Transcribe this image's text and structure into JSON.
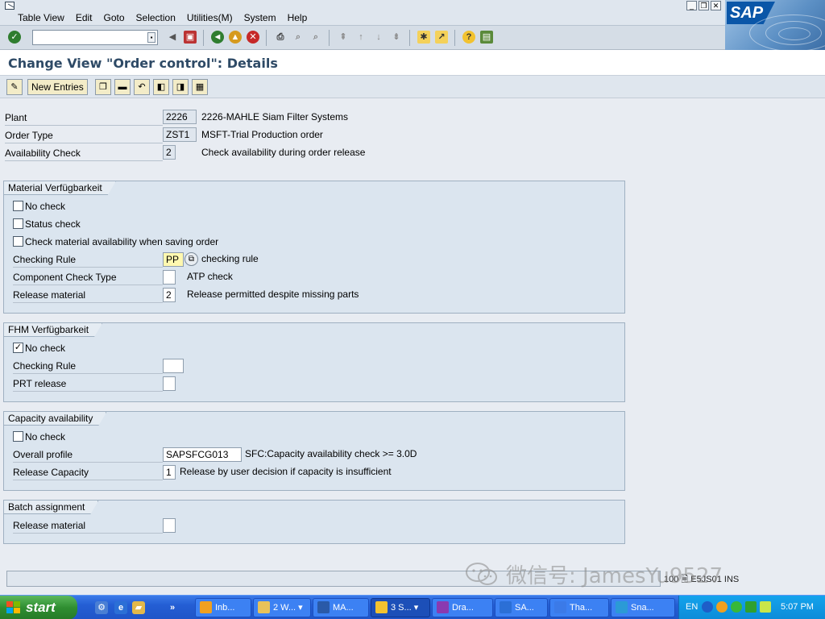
{
  "menubar": {
    "items": [
      "Table View",
      "Edit",
      "Goto",
      "Selection",
      "Utilities(M)",
      "System",
      "Help"
    ]
  },
  "brand": {
    "logo_text": "SAP",
    "accent": "#0a56a8"
  },
  "toolbar": {
    "command_field_value": ""
  },
  "title": "Change View \"Order control\": Details",
  "app_toolbar": {
    "new_entries_label": "New Entries"
  },
  "header": {
    "plant": {
      "label": "Plant",
      "value": "2226",
      "desc": "2226-MAHLE Siam Filter Systems"
    },
    "order_type": {
      "label": "Order Type",
      "value": "ZST1",
      "desc": "MSFT-Trial Production order"
    },
    "availability_check": {
      "label": "Availability Check",
      "value": "2",
      "desc": "Check availability during order release"
    }
  },
  "material_group": {
    "title": "Material Verfügbarkeit",
    "no_check": {
      "label": "No check",
      "checked": false
    },
    "status_check": {
      "label": "Status check",
      "checked": false
    },
    "check_on_save": {
      "label": "Check material availability when saving order",
      "checked": false
    },
    "checking_rule": {
      "label": "Checking Rule",
      "value": "PP",
      "desc": "checking rule"
    },
    "component_check_type": {
      "label": "Component Check Type",
      "value": "",
      "desc": "ATP check"
    },
    "release_material": {
      "label": "Release material",
      "value": "2",
      "desc": "Release permitted despite missing parts"
    }
  },
  "fhm_group": {
    "title": "FHM Verfügbarkeit",
    "no_check": {
      "label": "No check",
      "checked": true
    },
    "checking_rule": {
      "label": "Checking Rule",
      "value": ""
    },
    "prt_release": {
      "label": "PRT release",
      "value": ""
    }
  },
  "capacity_group": {
    "title": "Capacity availability",
    "no_check": {
      "label": "No check",
      "checked": false
    },
    "overall_profile": {
      "label": "Overall profile",
      "value": "SAPSFCG013",
      "desc": "SFC:Capacity availability check >= 3.0D"
    },
    "release_capacity": {
      "label": "Release Capacity",
      "value": "1",
      "desc": "Release by user decision if capacity is insufficient"
    }
  },
  "batch_group": {
    "title": "Batch assignment",
    "release_material": {
      "label": "Release material",
      "value": ""
    }
  },
  "statusbar": {
    "sys_info": "100 🗎 E5JS01 INS"
  },
  "watermark": {
    "text": "微信号: JamesYu9527"
  },
  "taskbar": {
    "start_label": "start",
    "tasks": [
      "Inb...",
      "2 W...",
      "MA...",
      "3 S...",
      "Dra...",
      "SA...",
      "Tha...",
      "Sna..."
    ],
    "lang": "EN",
    "clock": "5:07 PM"
  }
}
